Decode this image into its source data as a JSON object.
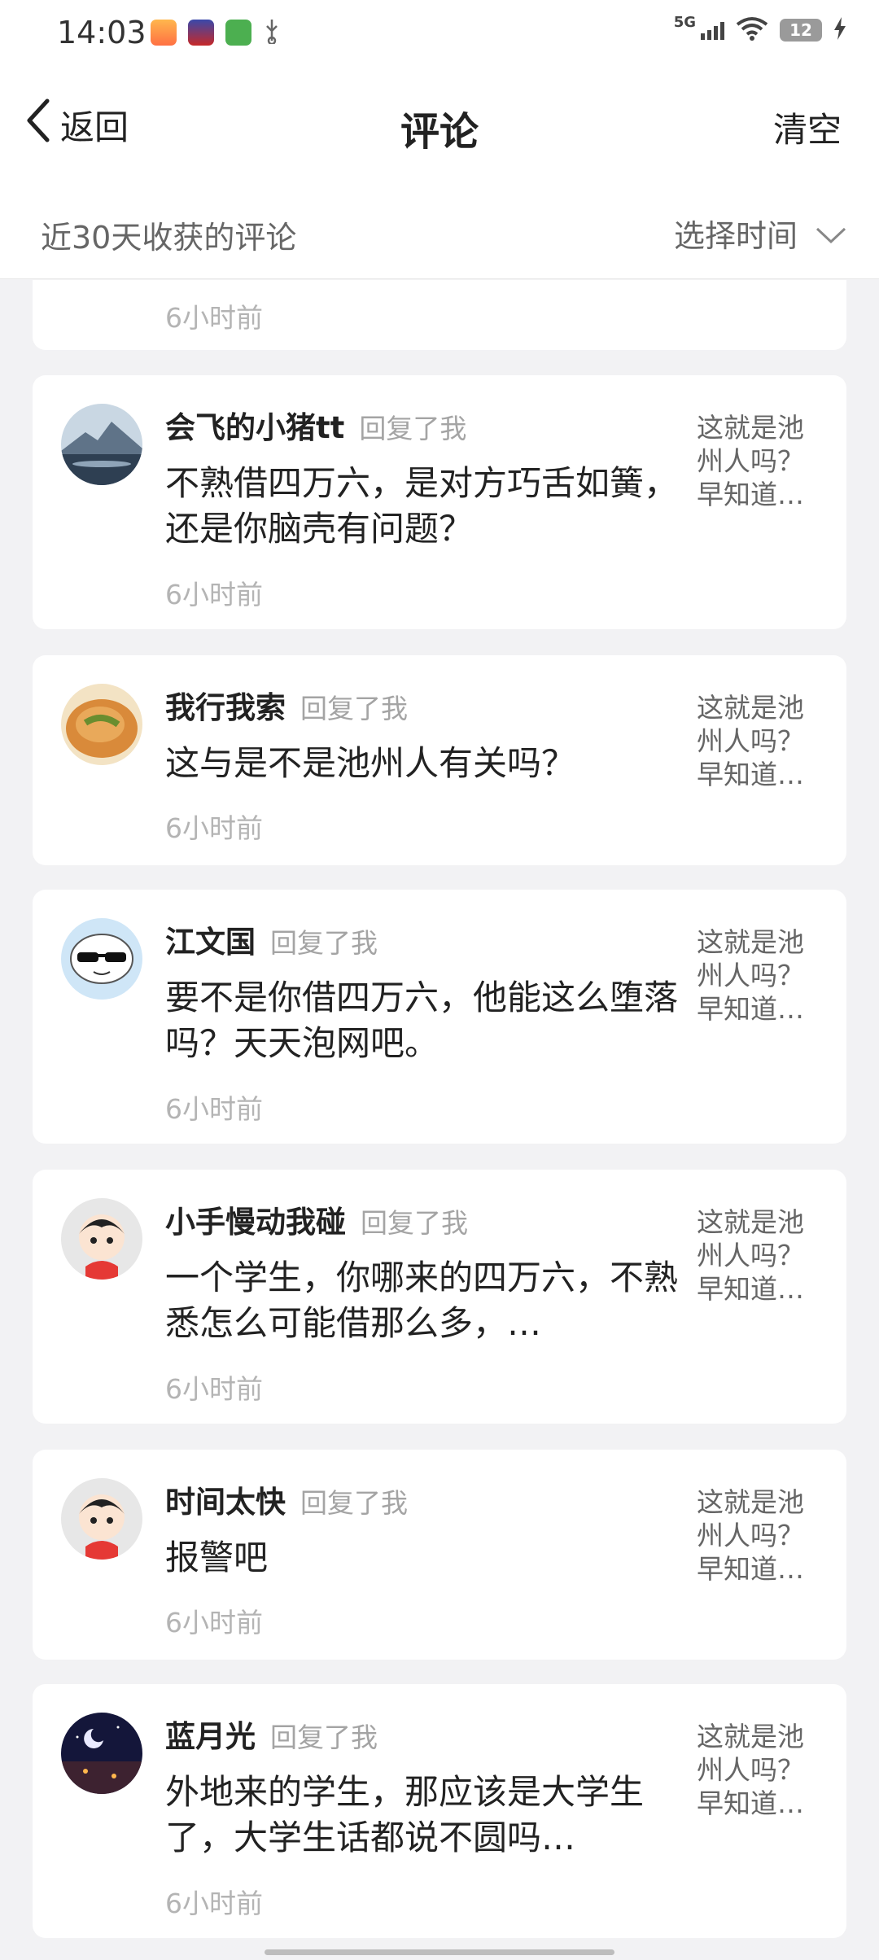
{
  "status_bar": {
    "time": "14:03",
    "network": "5G",
    "battery": "12"
  },
  "nav": {
    "back_label": "返回",
    "title": "评论",
    "clear_label": "清空"
  },
  "filter": {
    "label": "近30天收获的评论",
    "select_label": "选择时间"
  },
  "partial_card": {
    "time": "6小时前"
  },
  "comments": [
    {
      "name": "会飞的小猪tt",
      "replied": "回复了我",
      "text": "不熟借四万六，是对方巧舌如簧，还是你脑壳有问题？",
      "original": "这就是池州人吗？早知道…",
      "time": "6小时前"
    },
    {
      "name": "我行我索",
      "replied": "回复了我",
      "text": "这与是不是池州人有关吗？",
      "original": "这就是池州人吗？早知道…",
      "time": "6小时前"
    },
    {
      "name": "江文国",
      "replied": "回复了我",
      "text": "要不是你借四万六，他能这么堕落吗？天天泡网吧。",
      "original": "这就是池州人吗？早知道…",
      "time": "6小时前"
    },
    {
      "name": "小手慢动我碰",
      "replied": "回复了我",
      "text": "一个学生，你哪来的四万六，不熟悉怎么可能借那么多，…",
      "original": "这就是池州人吗？早知道…",
      "time": "6小时前"
    },
    {
      "name": "时间太快",
      "replied": "回复了我",
      "text": "报警吧",
      "original": "这就是池州人吗？早知道…",
      "time": "6小时前"
    },
    {
      "name": "蓝月光",
      "replied": "回复了我",
      "text": "外地来的学生，那应该是大学生了，大学生话都说不圆吗…",
      "original": "这就是池州人吗？早知道…",
      "time": "6小时前"
    }
  ],
  "colors": {
    "background": "#f2f2f4",
    "card": "#ffffff",
    "secondary_text": "#a4a4a4"
  }
}
